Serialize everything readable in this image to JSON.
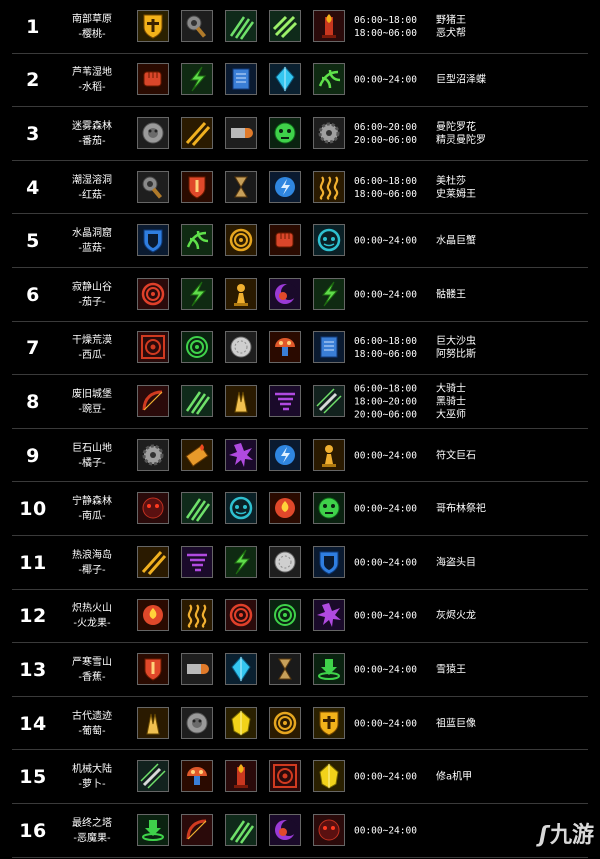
{
  "rows": [
    {
      "num": "1",
      "region": "南部草原",
      "crop": "-樱桃-",
      "icons": [
        "shield",
        "gear-hammer",
        "triple-slash",
        "claw-slash",
        "flame-totem"
      ],
      "times": [
        "06:00~18:00",
        "18:00~06:00"
      ],
      "bosses": [
        "野猪王",
        "恶犬帮"
      ]
    },
    {
      "num": "2",
      "region": "芦苇湿地",
      "crop": "-水稻-",
      "icons": [
        "fist",
        "lightning-slash",
        "book",
        "blue-crystal",
        "swirl-green"
      ],
      "times": [
        "00:00~24:00"
      ],
      "bosses": [
        "巨型沼泽蝶"
      ]
    },
    {
      "num": "3",
      "region": "迷雾森林",
      "crop": "-番茄-",
      "icons": [
        "lion-head",
        "double-slash",
        "bullet",
        "green-mask",
        "gear"
      ],
      "times": [
        "06:00~20:00",
        "20:00~06:00"
      ],
      "bosses": [
        "曼陀罗花",
        "精灵曼陀罗"
      ]
    },
    {
      "num": "4",
      "region": "潮湿溶洞",
      "crop": "-红菇-",
      "icons": [
        "gear-hammer",
        "red-shield",
        "hourglass",
        "bolt-orb",
        "wave"
      ],
      "times": [
        "06:00~18:00",
        "18:00~06:00"
      ],
      "bosses": [
        "美杜莎",
        "史莱姆王"
      ]
    },
    {
      "num": "5",
      "region": "水晶洞窟",
      "crop": "-蓝菇-",
      "icons": [
        "blue-shield",
        "swirl-green",
        "yellow-ring",
        "fist",
        "cyan-face"
      ],
      "times": [
        "00:00~24:00"
      ],
      "bosses": [
        "水晶巨蟹"
      ]
    },
    {
      "num": "6",
      "region": "寂静山谷",
      "crop": "-茄子-",
      "icons": [
        "red-ring",
        "lightning-slash",
        "pawn",
        "crescent",
        "lightning-slash"
      ],
      "times": [
        "00:00~24:00"
      ],
      "bosses": [
        "骷髅王"
      ]
    },
    {
      "num": "7",
      "region": "干燥荒漠",
      "crop": "-西瓜-",
      "icons": [
        "red-target",
        "green-target",
        "silver-orb",
        "mushroom",
        "book"
      ],
      "times": [
        "06:00~18:00",
        "18:00~06:00"
      ],
      "bosses": [
        "巨大沙虫",
        "阿努比斯"
      ]
    },
    {
      "num": "8",
      "region": "废旧城堡",
      "crop": "-豌豆-",
      "icons": [
        "red-bow",
        "triple-slash",
        "hands",
        "tornado",
        "sword-slash"
      ],
      "times": [
        "06:00~18:00",
        "18:00~20:00",
        "20:00~06:00"
      ],
      "bosses": [
        "大骑士",
        "黑骑士",
        "大巫师"
      ]
    },
    {
      "num": "9",
      "region": "巨石山地",
      "crop": "-橘子-",
      "icons": [
        "gear",
        "fire-scroll",
        "purple-burst",
        "bolt-orb",
        "pawn"
      ],
      "times": [
        "00:00~24:00"
      ],
      "bosses": [
        "符文巨石"
      ]
    },
    {
      "num": "10",
      "region": "宁静森林",
      "crop": "-南瓜-",
      "icons": [
        "red-face",
        "triple-slash",
        "cyan-face",
        "fire-orb",
        "green-mask"
      ],
      "times": [
        "00:00~24:00"
      ],
      "bosses": [
        "哥布林祭祀"
      ]
    },
    {
      "num": "11",
      "region": "热浪海岛",
      "crop": "-椰子-",
      "icons": [
        "double-slash",
        "tornado",
        "lightning-slash",
        "silver-orb",
        "blue-shield"
      ],
      "times": [
        "00:00~24:00"
      ],
      "bosses": [
        "海盗头目"
      ]
    },
    {
      "num": "12",
      "region": "炽热火山",
      "crop": "-火龙果-",
      "icons": [
        "fire-orb",
        "wave",
        "red-ring",
        "green-target",
        "purple-burst"
      ],
      "times": [
        "00:00~24:00"
      ],
      "bosses": [
        "灰烬火龙"
      ]
    },
    {
      "num": "13",
      "region": "严寒雪山",
      "crop": "-香蕉-",
      "icons": [
        "red-shield",
        "bullet",
        "blue-crystal",
        "hourglass",
        "green-down"
      ],
      "times": [
        "00:00~24:00"
      ],
      "bosses": [
        "雪猿王"
      ]
    },
    {
      "num": "14",
      "region": "古代遗迹",
      "crop": "-葡萄-",
      "icons": [
        "hands",
        "lion-head",
        "yellow-crystal",
        "yellow-ring",
        "shield"
      ],
      "times": [
        "00:00~24:00"
      ],
      "bosses": [
        "祖蓝巨像"
      ]
    },
    {
      "num": "15",
      "region": "机械大陆",
      "crop": "-萝卜-",
      "icons": [
        "sword-slash",
        "mushroom",
        "flame-totem",
        "red-target",
        "yellow-crystal"
      ],
      "times": [
        "00:00~24:00"
      ],
      "bosses": [
        "修a机甲"
      ]
    },
    {
      "num": "16",
      "region": "最终之塔",
      "crop": "-恶魔果-",
      "icons": [
        "green-down",
        "red-bow",
        "triple-slash",
        "crescent",
        "red-face"
      ],
      "times": [
        "00:00~24:00"
      ],
      "bosses": [
        ""
      ]
    }
  ],
  "watermark": {
    "mark": "ʃ",
    "text": "九游"
  }
}
